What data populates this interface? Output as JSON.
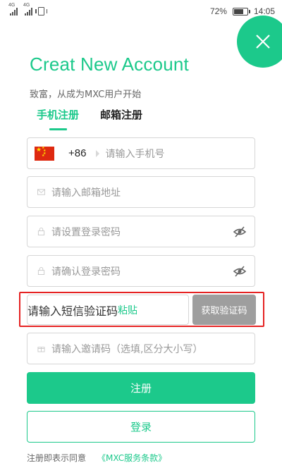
{
  "status_bar": {
    "network_1": "4G",
    "network_2": "4G",
    "battery": "72%",
    "battery_level": 0.72,
    "time": "14:05"
  },
  "header": {
    "title": "Creat New Account",
    "subtitle": "致富，从成为MXC用户开始"
  },
  "tabs": [
    {
      "label": "手机注册",
      "active": true
    },
    {
      "label": "邮箱注册",
      "active": false
    }
  ],
  "form": {
    "country_code": "+86",
    "phone_placeholder": "请输入手机号",
    "email_placeholder": "请输入邮箱地址",
    "password_placeholder": "请设置登录密码",
    "confirm_password_placeholder": "请确认登录密码",
    "sms_placeholder": "请输入短信验证码",
    "paste_label": "粘贴",
    "get_code_label": "获取验证码",
    "invite_placeholder": "请输入邀请码（选填,区分大小写）"
  },
  "actions": {
    "register_label": "注册",
    "login_label": "登录"
  },
  "terms": {
    "text": "注册即表示同意",
    "link": "《MXC服务条款》"
  },
  "colors": {
    "accent": "#1cc98b",
    "highlight": "#e52222",
    "disabled": "#9e9e9e"
  }
}
